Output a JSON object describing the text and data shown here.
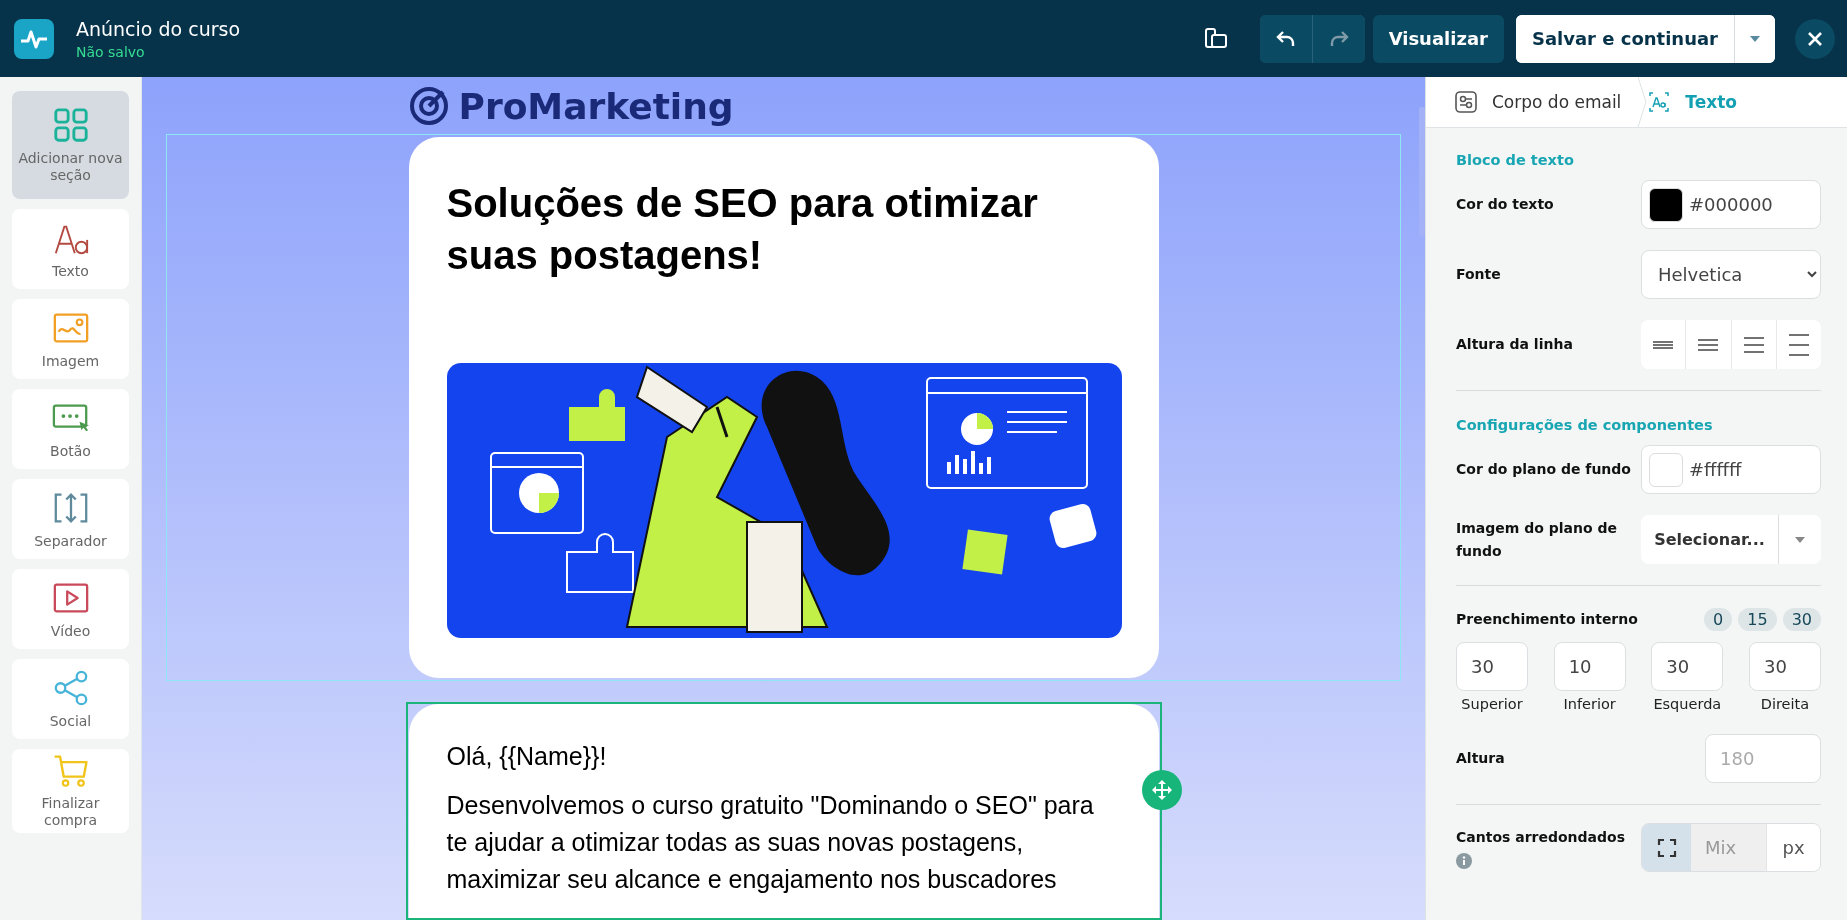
{
  "header": {
    "title": "Anúncio do curso",
    "status": "Não salvo",
    "redo_disabled": true,
    "preview": "Visualizar",
    "save": "Salvar e continuar"
  },
  "sidebar": {
    "items": [
      {
        "kind": "grid",
        "label": "Adicionar nova seção",
        "selected": true
      },
      {
        "kind": "text",
        "label": "Texto",
        "selected": false
      },
      {
        "kind": "image",
        "label": "Imagem",
        "selected": false
      },
      {
        "kind": "button",
        "label": "Botão",
        "selected": false
      },
      {
        "kind": "separator",
        "label": "Separador",
        "selected": false
      },
      {
        "kind": "video",
        "label": "Vídeo",
        "selected": false
      },
      {
        "kind": "social",
        "label": "Social",
        "selected": false
      },
      {
        "kind": "cart",
        "label": "Finalizar compra",
        "selected": false
      }
    ]
  },
  "canvas": {
    "logo": "ProMarketing",
    "sections": [
      {
        "kind": "hero",
        "heading": "Soluções de SEO para otimizar suas postagens!",
        "highlighted": true,
        "selected": false
      },
      {
        "kind": "text",
        "greeting": "Olá, {{Name}}!",
        "paragraph": "Desenvolvemos o curso gratuito \"Dominando o SEO\" para te ajudar a otimizar todas as suas novas postagens, maximizar seu alcance e engajamento nos buscadores",
        "highlighted": false,
        "selected": true
      }
    ]
  },
  "panel": {
    "breadcrumb": [
      {
        "label": "Corpo do email",
        "selected": false
      },
      {
        "label": "Texto",
        "selected": true
      }
    ],
    "text_block": {
      "title": "Bloco de texto",
      "text_color": {
        "label": "Cor do texto",
        "value": "#000000"
      },
      "font": {
        "label": "Fonte",
        "value": "Helvetica"
      },
      "line_height": {
        "label": "Altura da linha",
        "options": [
          {
            "selected": false
          },
          {
            "selected": false
          },
          {
            "selected": false
          },
          {
            "selected": false
          }
        ]
      }
    },
    "component_settings": {
      "title": "Configurações de componentes",
      "background_color": {
        "label": "Cor do plano de fundo",
        "value": "#ffffff"
      },
      "background_image": {
        "label": "Imagem do plano de fundo",
        "value": "Selecionar..."
      },
      "padding": {
        "label": "Preenchimento interno",
        "presets": [
          "0",
          "15",
          "30"
        ],
        "fields": [
          {
            "value": "30",
            "label": "Superior"
          },
          {
            "value": "10",
            "label": "Inferior"
          },
          {
            "value": "30",
            "label": "Esquerda"
          },
          {
            "value": "30",
            "label": "Direita"
          }
        ]
      },
      "height": {
        "label": "Altura",
        "placeholder": "180"
      },
      "corners": {
        "label": "Cantos arredondados",
        "uniform_selected": true,
        "placeholder": "Mix",
        "unit": "px"
      }
    }
  }
}
